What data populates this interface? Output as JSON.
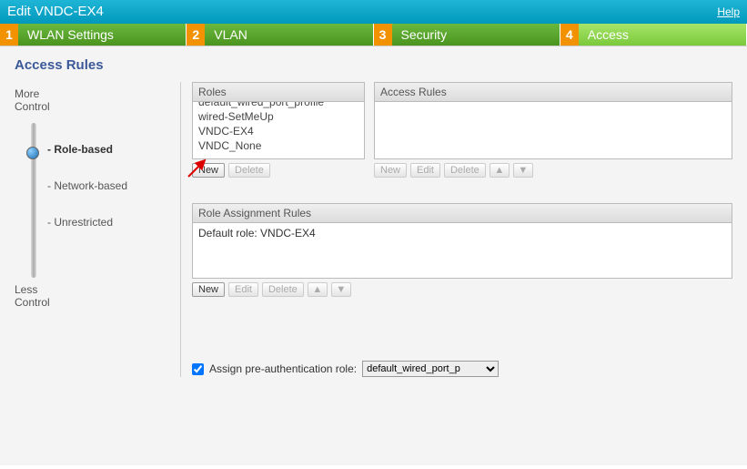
{
  "titlebar": {
    "title": "Edit VNDC-EX4",
    "help": "Help"
  },
  "tabs": [
    {
      "num": "1",
      "label": "WLAN Settings"
    },
    {
      "num": "2",
      "label": "VLAN"
    },
    {
      "num": "3",
      "label": "Security"
    },
    {
      "num": "4",
      "label": "Access"
    }
  ],
  "section_title": "Access Rules",
  "sidebar": {
    "more": "More\nControl",
    "less": "Less\nControl",
    "items": [
      {
        "label": "- Role-based",
        "selected": true
      },
      {
        "label": "- Network-based",
        "selected": false
      },
      {
        "label": "- Unrestricted",
        "selected": false
      }
    ]
  },
  "roles": {
    "header": "Roles",
    "items": [
      "default_wired_port_profile",
      "wired-SetMeUp",
      "VNDC-EX4",
      "VNDC_None"
    ],
    "new": "New",
    "delete": "Delete"
  },
  "rules": {
    "header": "Access Rules",
    "new": "New",
    "edit": "Edit",
    "delete": "Delete"
  },
  "assignment": {
    "header": "Role Assignment Rules",
    "default_text": "Default role: VNDC-EX4",
    "new": "New",
    "edit": "Edit",
    "delete": "Delete"
  },
  "preauth": {
    "label": "Assign pre-authentication role:",
    "value": "default_wired_port_p"
  },
  "icons": {
    "up": "▲",
    "down": "▼"
  }
}
